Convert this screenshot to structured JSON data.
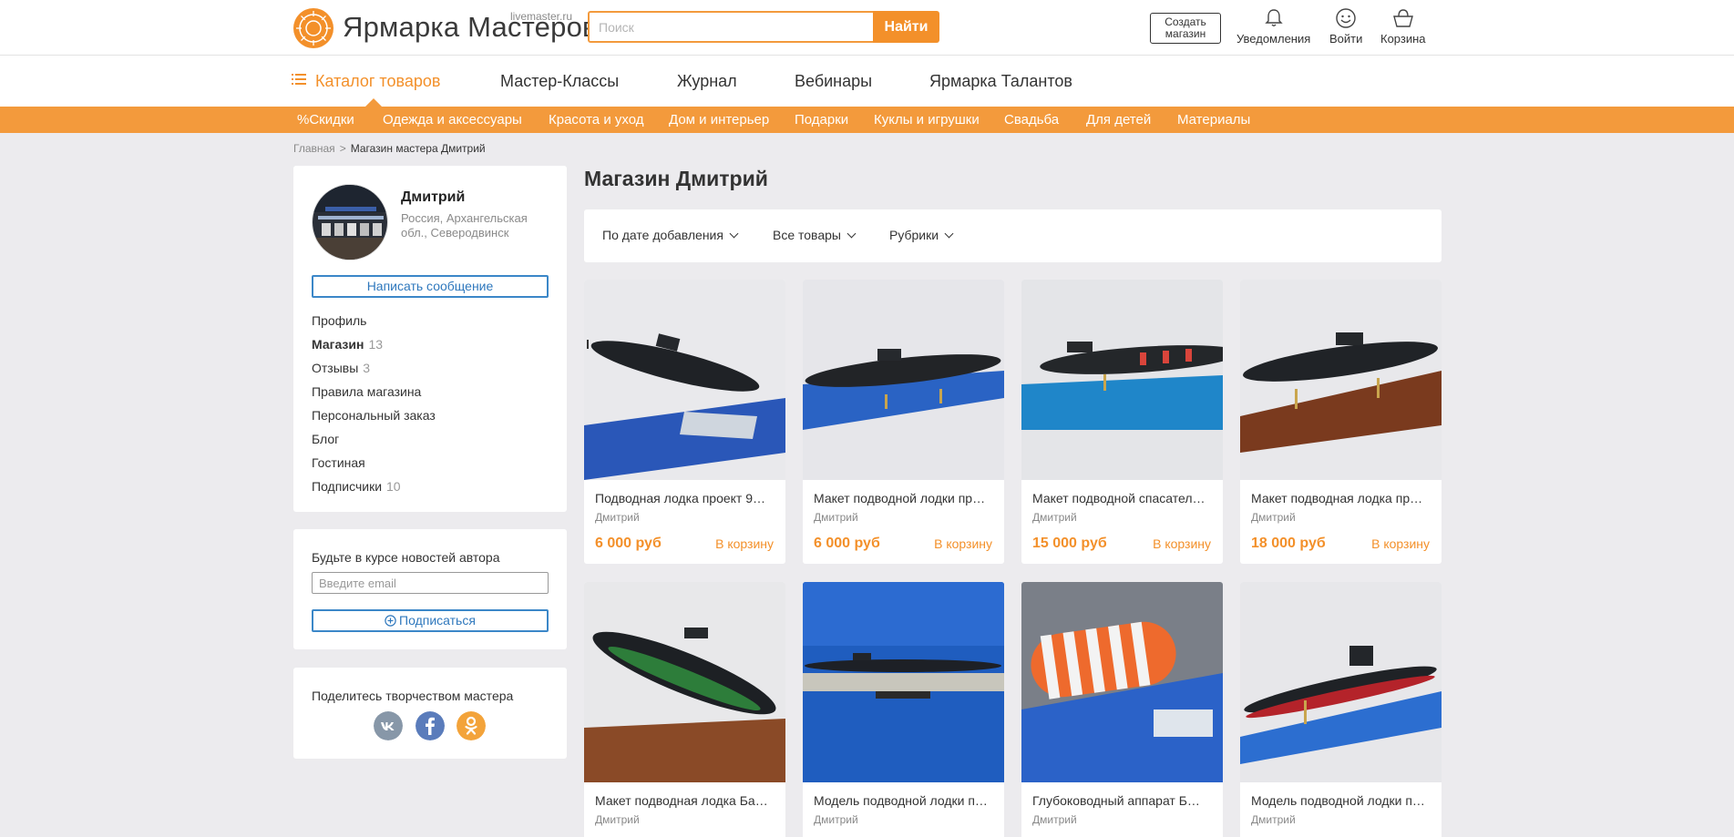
{
  "header": {
    "logo_text": "Ярмарка Мастеров",
    "logo_domain": "livemaster.ru",
    "search_placeholder": "Поиск",
    "search_button": "Найти",
    "create_shop": "Создать магазин",
    "notifications": "Уведомления",
    "login": "Войти",
    "cart": "Корзина"
  },
  "mainnav": {
    "catalog": "Каталог товаров",
    "items": [
      "Мастер-Классы",
      "Журнал",
      "Вебинары",
      "Ярмарка Талантов"
    ]
  },
  "categories": [
    "%Скидки",
    "Одежда и аксессуары",
    "Красота и уход",
    "Дом и интерьер",
    "Подарки",
    "Куклы и игрушки",
    "Свадьба",
    "Для детей",
    "Материалы"
  ],
  "breadcrumb": {
    "home": "Главная",
    "separator": ">",
    "current": "Магазин мастера Дмитрий"
  },
  "seller": {
    "name": "Дмитрий",
    "location": "Россия, Архангельская обл., Северодвинск",
    "message_button": "Написать сообщение",
    "menu": [
      {
        "label": "Профиль",
        "count": ""
      },
      {
        "label": "Магазин",
        "count": "13"
      },
      {
        "label": "Отзывы",
        "count": "3"
      },
      {
        "label": "Правила магазина",
        "count": ""
      },
      {
        "label": "Персональный заказ",
        "count": ""
      },
      {
        "label": "Блог",
        "count": ""
      },
      {
        "label": "Гостиная",
        "count": ""
      },
      {
        "label": "Подписчики",
        "count": "10"
      }
    ]
  },
  "subscribe": {
    "title": "Будьте в курсе новостей автора",
    "email_placeholder": "Введите email",
    "button": "Подписаться"
  },
  "share": {
    "title": "Поделитесь творчеством мастера",
    "networks": [
      "vk-icon",
      "facebook-icon",
      "odnoklassniki-icon"
    ]
  },
  "shop": {
    "title": "Магазин Дмитрий",
    "filters": [
      "По дате добавления",
      "Все товары",
      "Рубрики"
    ]
  },
  "products": [
    {
      "title": "Подводная лодка проект 9…",
      "author": "Дмитрий",
      "price": "6 000 руб",
      "cart": "В корзину"
    },
    {
      "title": "Макет подводной лодки пр…",
      "author": "Дмитрий",
      "price": "6 000 руб",
      "cart": "В корзину"
    },
    {
      "title": "Макет подводной спасател…",
      "author": "Дмитрий",
      "price": "15 000 руб",
      "cart": "В корзину"
    },
    {
      "title": "Макет подводная лодка пр…",
      "author": "Дмитрий",
      "price": "18 000 руб",
      "cart": "В корзину"
    },
    {
      "title": "Макет подводная лодка Ба…",
      "author": "Дмитрий",
      "price": "",
      "cart": ""
    },
    {
      "title": "Модель подводной лодки п…",
      "author": "Дмитрий",
      "price": "",
      "cart": ""
    },
    {
      "title": "Глубоководный аппарат Б…",
      "author": "Дмитрий",
      "price": "",
      "cart": ""
    },
    {
      "title": "Модель подводной лодки п…",
      "author": "Дмитрий",
      "price": "",
      "cart": ""
    }
  ],
  "colors": {
    "accent": "#f3902a",
    "catbar": "#f39a3c",
    "link_blue": "#2f78bd",
    "background": "#ecebee"
  }
}
